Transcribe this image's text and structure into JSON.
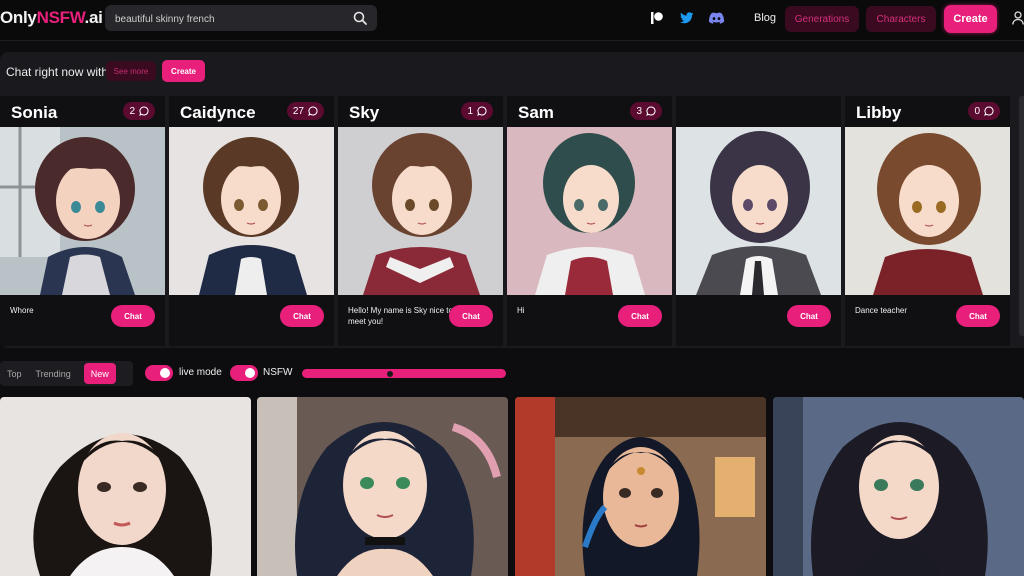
{
  "header": {
    "logo_prefix": "Only",
    "logo_accent": "NSFW",
    "logo_suffix": ".ai",
    "search_value": "beautiful skinny french",
    "blog": "Blog",
    "generations": "Generations",
    "characters": "Characters",
    "create": "Create",
    "social_icons": [
      "patreon-icon",
      "twitter-icon",
      "discord-icon"
    ]
  },
  "chat_row": {
    "heading": "Chat right now with",
    "see_more": "See more",
    "create": "Create",
    "cards": [
      {
        "name": "Sonia",
        "count": "2",
        "desc": "Whore",
        "chat": "Chat"
      },
      {
        "name": "Caidynce",
        "count": "27",
        "desc": "",
        "chat": "Chat"
      },
      {
        "name": "Sky",
        "count": "1",
        "desc": "Hello! My name is Sky nice to meet you!",
        "chat": "Chat"
      },
      {
        "name": "Sam",
        "count": "3",
        "desc": "Hi",
        "chat": "Chat"
      },
      {
        "name": "",
        "count": "",
        "desc": "",
        "chat": "Chat"
      },
      {
        "name": "Libby",
        "count": "0",
        "desc": "Dance teacher",
        "chat": "Chat"
      }
    ]
  },
  "filters": {
    "tabs": [
      "Top",
      "Trending",
      "New"
    ],
    "active_tab": "New",
    "live_mode": "live mode",
    "nsfw": "NSFW",
    "slider_value": 0.43
  },
  "colors": {
    "accent": "#e8207c",
    "background": "#0d0d0f",
    "panel": "#1a1a1e"
  }
}
